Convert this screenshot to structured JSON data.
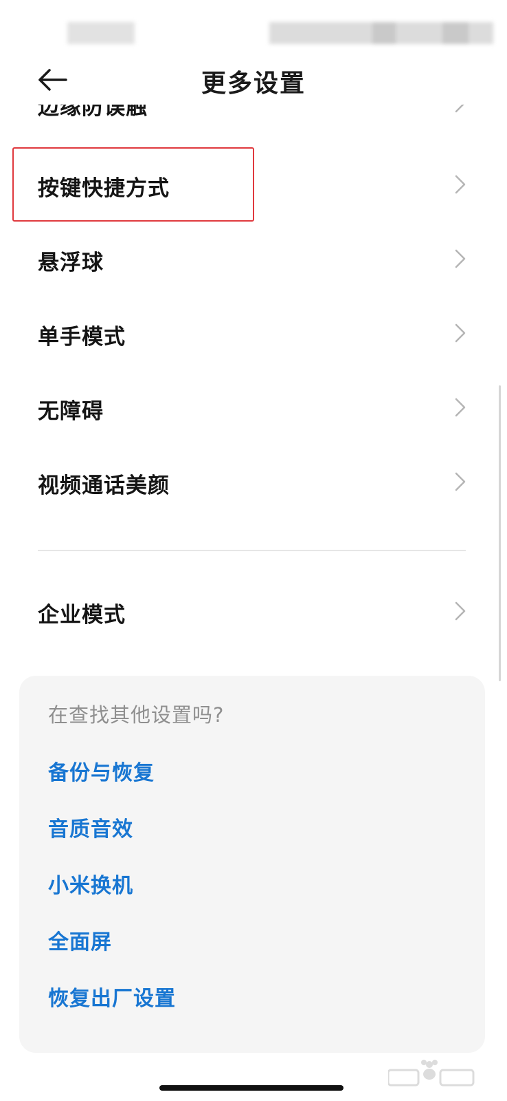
{
  "header": {
    "title": "更多设置"
  },
  "partial_item": {
    "label": "边缘防误触"
  },
  "menu": {
    "items": [
      {
        "label": "按键快捷方式"
      },
      {
        "label": "悬浮球"
      },
      {
        "label": "单手模式"
      },
      {
        "label": "无障碍"
      },
      {
        "label": "视频通话美颜"
      }
    ],
    "enterprise": {
      "label": "企业模式"
    }
  },
  "suggestions": {
    "title": "在查找其他设置吗?",
    "links": [
      {
        "label": "备份与恢复"
      },
      {
        "label": "音质音效"
      },
      {
        "label": "小米换机"
      },
      {
        "label": "全面屏"
      },
      {
        "label": "恢复出厂设置"
      }
    ]
  },
  "colors": {
    "highlight": "#e0393e",
    "link": "#1876d2"
  }
}
